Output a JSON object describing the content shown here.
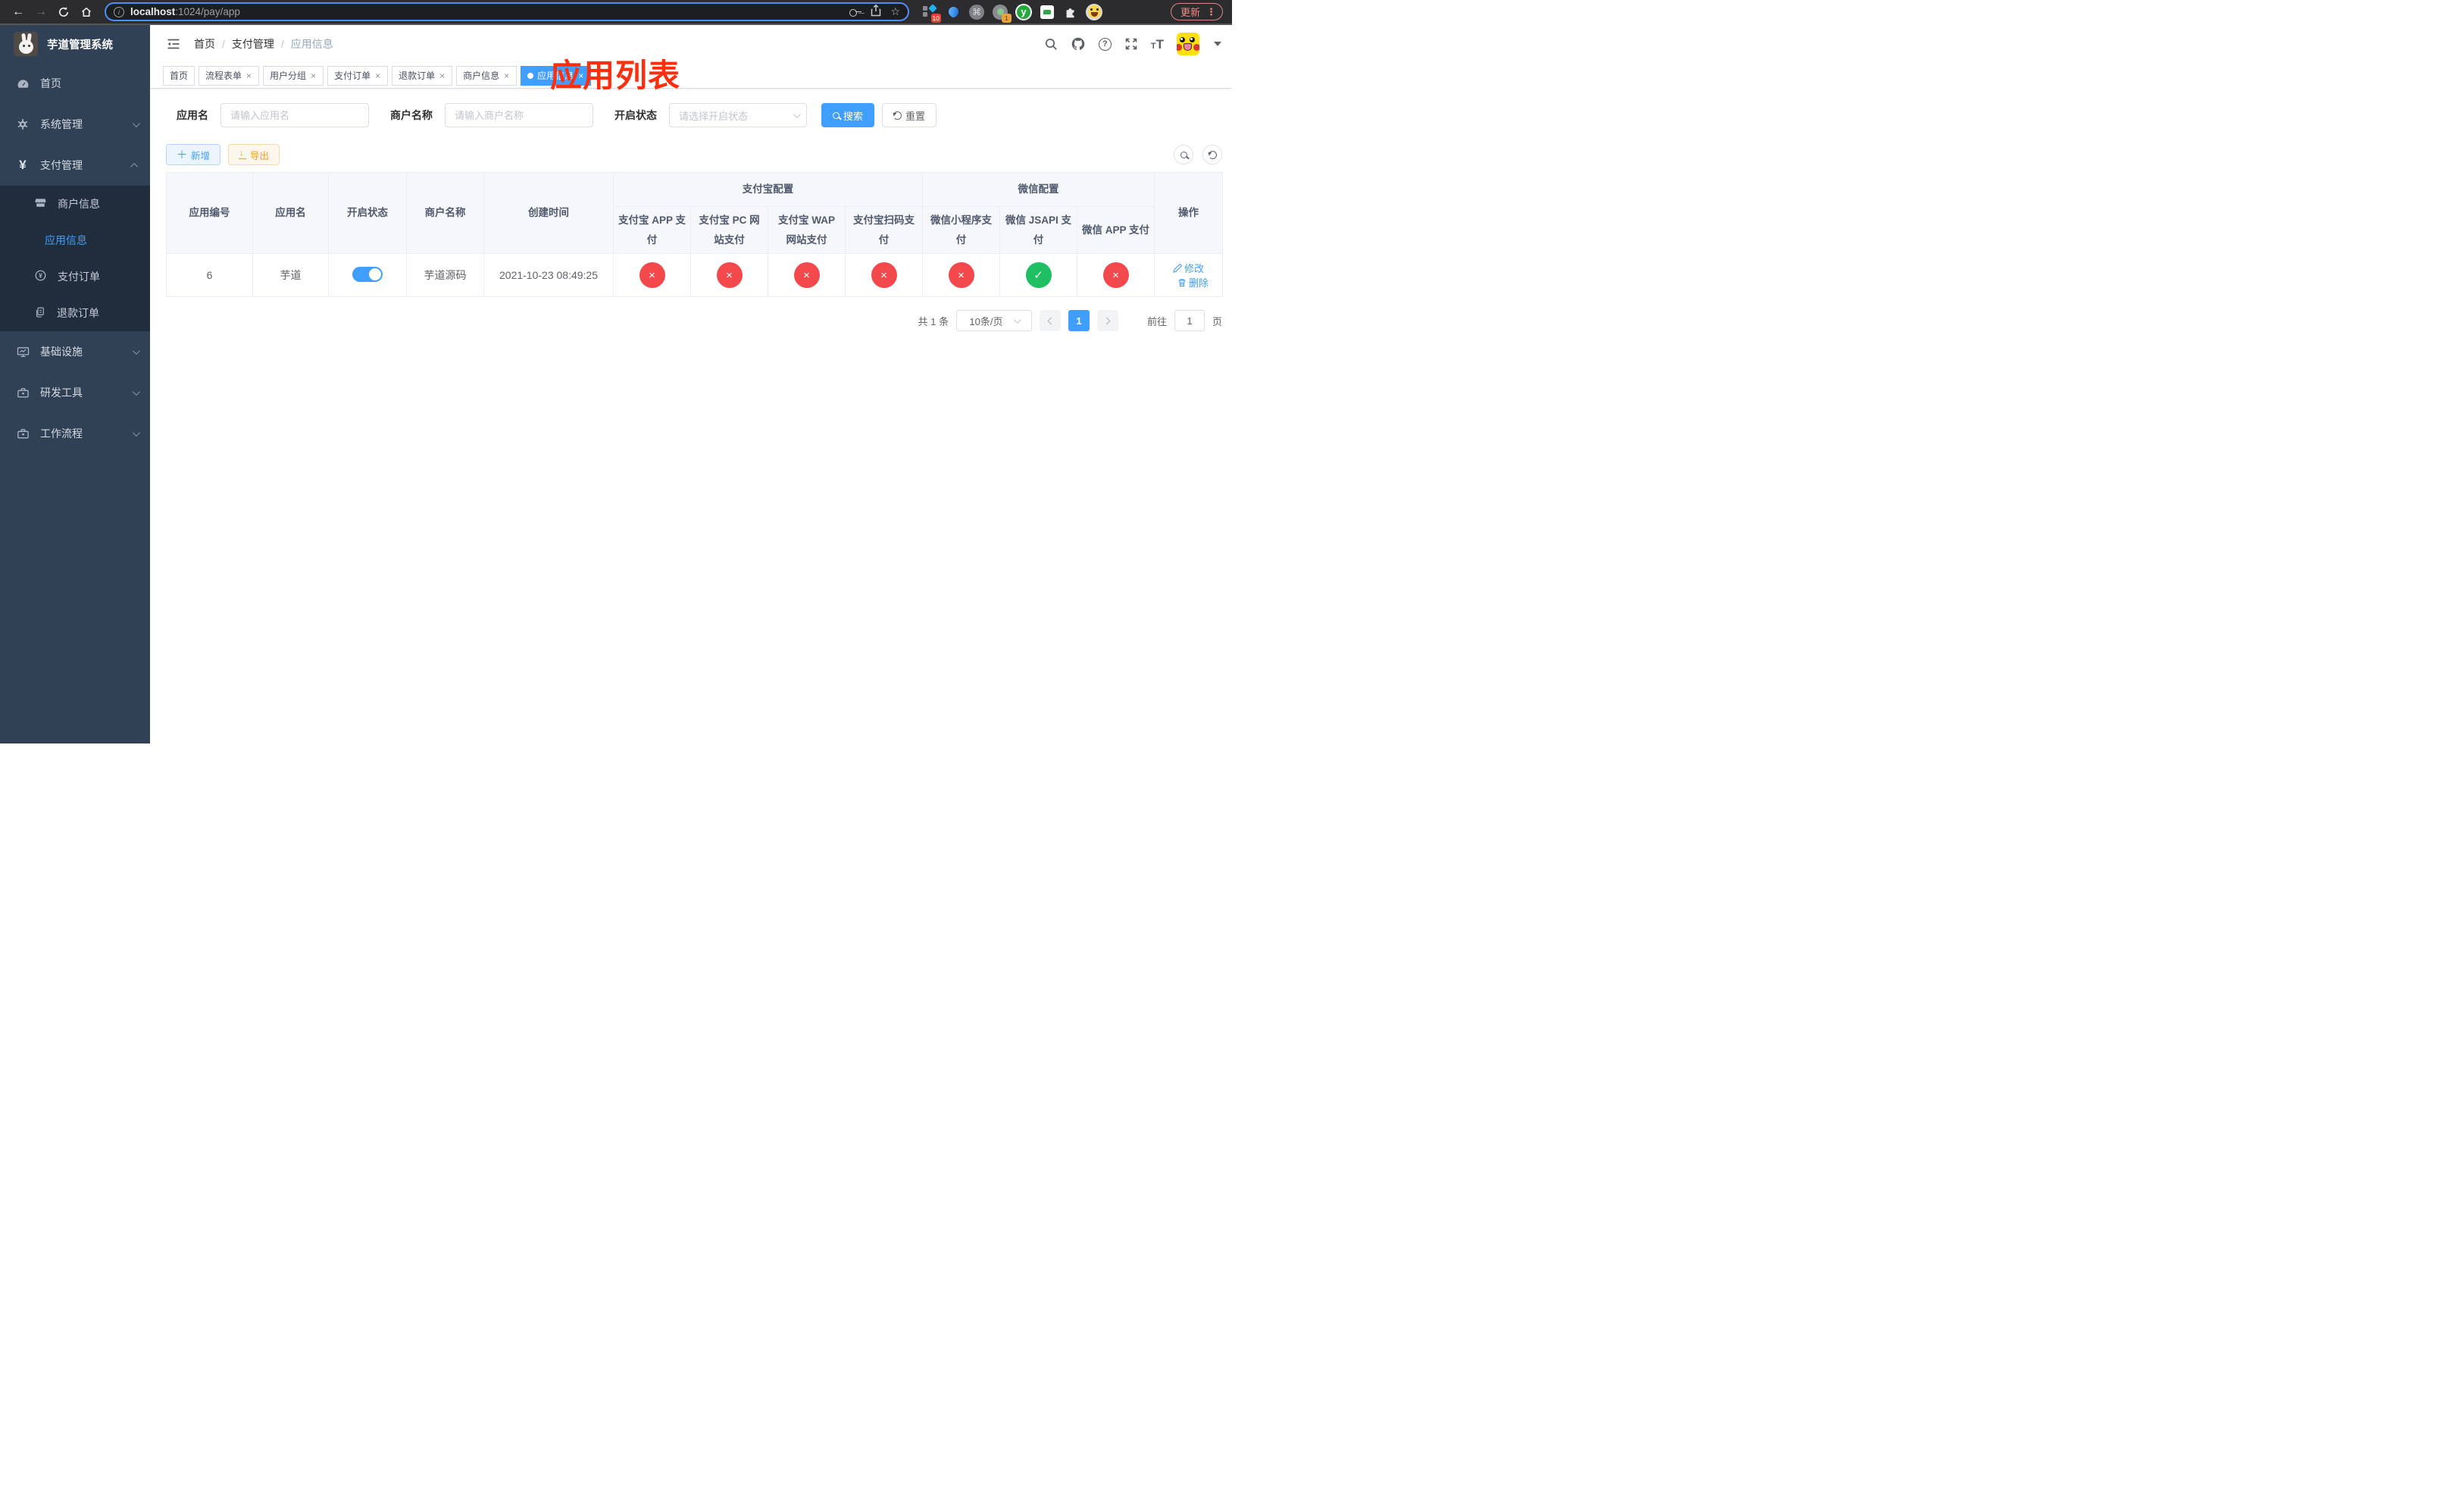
{
  "browser": {
    "url_host": "localhost",
    "url_rest": ":1024/pay/app",
    "update_label": "更新",
    "kebab": "⋮",
    "ext_badge_a": "10",
    "ext_badge_b": "1",
    "ext_y_label": "y",
    "cmd_glyph": "⌘"
  },
  "sidebar": {
    "title": "芋道管理系统",
    "menu": [
      {
        "label": "首页"
      },
      {
        "label": "系统管理"
      },
      {
        "label": "支付管理"
      },
      {
        "label": "基础设施"
      },
      {
        "label": "研发工具"
      },
      {
        "label": "工作流程"
      }
    ],
    "submenu": [
      {
        "label": "商户信息"
      },
      {
        "label": "应用信息"
      },
      {
        "label": "支付订单"
      },
      {
        "label": "退款订单"
      }
    ]
  },
  "navbar": {
    "breadcrumb": [
      "首页",
      "支付管理",
      "应用信息"
    ],
    "annotation": "应用列表",
    "help_glyph": "?"
  },
  "tabs": [
    {
      "label": "首页"
    },
    {
      "label": "流程表单"
    },
    {
      "label": "用户分组"
    },
    {
      "label": "支付订单"
    },
    {
      "label": "退款订单"
    },
    {
      "label": "商户信息"
    },
    {
      "label": "应用信息"
    }
  ],
  "filters": {
    "app_name_label": "应用名",
    "app_name_placeholder": "请输入应用名",
    "merchant_label": "商户名称",
    "merchant_placeholder": "请输入商户名称",
    "status_label": "开启状态",
    "status_placeholder": "请选择开启状态",
    "search_label": "搜索",
    "reset_label": "重置"
  },
  "toolbar": {
    "add_label": "新增",
    "export_label": "导出"
  },
  "table": {
    "groups": {
      "alipay": "支付宝配置",
      "wechat": "微信配置"
    },
    "columns": {
      "id": "应用编号",
      "name": "应用名",
      "status": "开启状态",
      "merchant": "商户名称",
      "created": "创建时间",
      "alipay_app": "支付宝 APP 支付",
      "alipay_pc": "支付宝 PC 网站支付",
      "alipay_wap": "支付宝 WAP 网站支付",
      "alipay_qr": "支付宝扫码支付",
      "wx_mini": "微信小程序支付",
      "wx_jsapi": "微信 JSAPI 支付",
      "wx_app": "微信 APP 支付",
      "actions": "操作"
    },
    "row": {
      "id": "6",
      "name": "芋道",
      "enabled": true,
      "merchant": "芋道源码",
      "created": "2021-10-23 08:49:25",
      "pay_status": [
        false,
        false,
        false,
        false,
        false,
        true,
        false
      ],
      "edit_label": "修改",
      "delete_label": "删除"
    }
  },
  "pagination": {
    "total": "共 1 条",
    "page_size": "10条/页",
    "page": "1",
    "goto_prefix": "前往",
    "goto_value": "1",
    "goto_suffix": "页"
  },
  "colors": {
    "primary": "#409eff",
    "success": "#1dbf62",
    "danger": "#f4494c",
    "warning": "#e6a23c",
    "annotation": "#fc2e0e",
    "sidebar_bg": "#304156",
    "submenu_bg": "#1f2d3d"
  }
}
